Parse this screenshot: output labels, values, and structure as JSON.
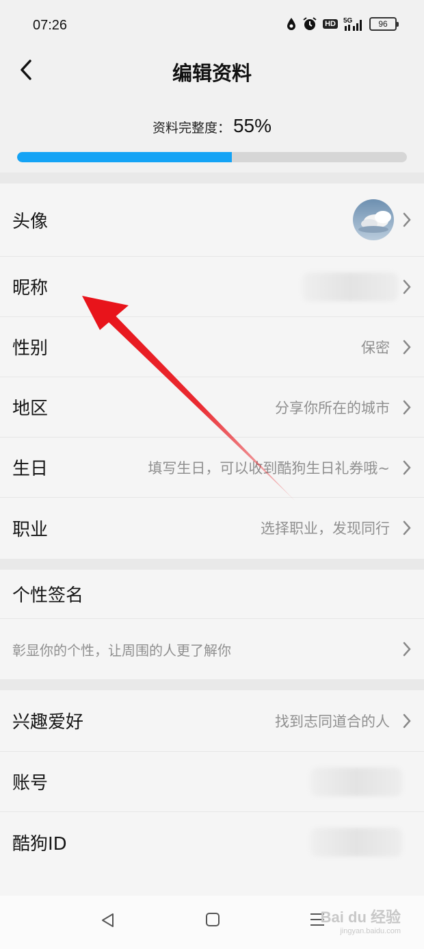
{
  "status_bar": {
    "time": "07:26",
    "hd": "HD",
    "network": "5G",
    "battery": "96",
    "icons": [
      "water-drop-icon",
      "alarm-icon",
      "hd-icon",
      "signal-5g-icon",
      "battery-icon"
    ]
  },
  "header": {
    "title": "编辑资料",
    "back_icon": "chevron-left-icon"
  },
  "completeness": {
    "label": "资料完整度：",
    "value": "55%",
    "progress": 0.55,
    "fill_color": "#14a3f5",
    "track_color": "#d6d6d6"
  },
  "section1": {
    "rows": [
      {
        "label": "头像",
        "value": ""
      },
      {
        "label": "昵称",
        "value": ""
      },
      {
        "label": "性别",
        "value": "保密"
      },
      {
        "label": "地区",
        "value": "分享你所在的城市"
      },
      {
        "label": "生日",
        "value": "填写生日，可以收到酷狗生日礼券哦~"
      },
      {
        "label": "职业",
        "value": "选择职业，发现同行"
      }
    ]
  },
  "section2": {
    "title": "个性签名",
    "placeholder": "彰显你的个性，让周围的人更了解你"
  },
  "section3": {
    "rows": [
      {
        "label": "兴趣爱好",
        "value": "找到志同道合的人"
      },
      {
        "label": "账号",
        "value": ""
      },
      {
        "label": "酷狗ID",
        "value": ""
      }
    ]
  },
  "system_nav": {
    "icons": [
      "back-triangle-icon",
      "home-square-icon",
      "menu-lines-icon"
    ]
  },
  "watermark": {
    "text": "Bai du 经验",
    "sub": "jingyan.baidu.com"
  },
  "annotation": {
    "arrow_color": "#e8141b"
  }
}
